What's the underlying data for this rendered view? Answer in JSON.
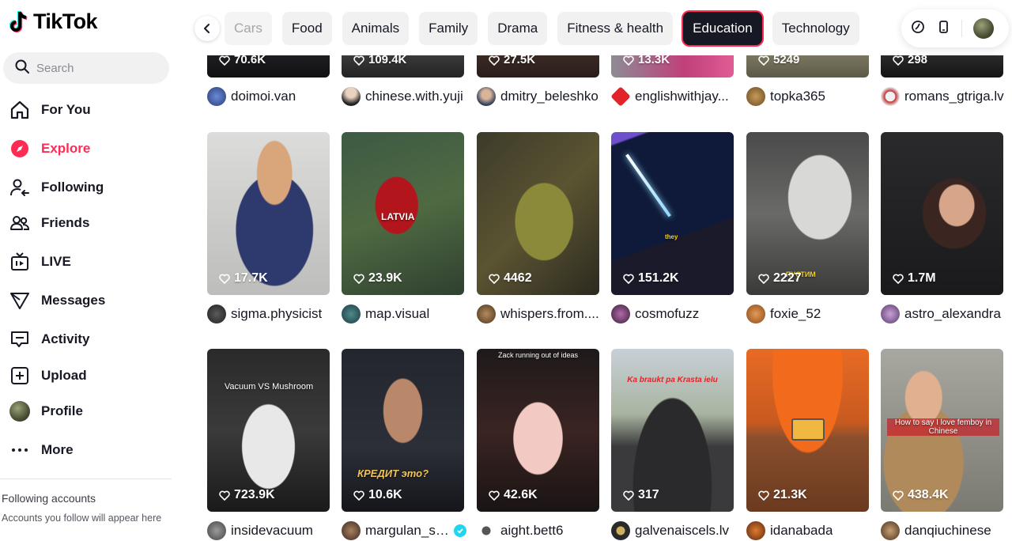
{
  "app": {
    "name": "TikTok"
  },
  "search": {
    "placeholder": "Search"
  },
  "nav": [
    {
      "label": "For You",
      "icon": "home-icon"
    },
    {
      "label": "Explore",
      "icon": "compass-icon",
      "active": true
    },
    {
      "label": "Following",
      "icon": "following-icon"
    },
    {
      "label": "Friends",
      "icon": "friends-icon"
    },
    {
      "label": "LIVE",
      "icon": "live-icon"
    },
    {
      "label": "Messages",
      "icon": "messages-icon"
    },
    {
      "label": "Activity",
      "icon": "activity-icon"
    },
    {
      "label": "Upload",
      "icon": "upload-icon"
    },
    {
      "label": "Profile",
      "icon": "profile-avatar"
    },
    {
      "label": "More",
      "icon": "more-icon"
    }
  ],
  "following_accounts": {
    "title": "Following accounts",
    "subtitle": "Accounts you follow will appear here"
  },
  "categories": [
    "Cars",
    "Food",
    "Animals",
    "Family",
    "Drama",
    "Fitness & health",
    "Education",
    "Technology"
  ],
  "active_category": "Education",
  "colors": {
    "accent": "#fe2c55",
    "verified": "#20d5ec",
    "chip_bg": "#f1f1f2"
  },
  "rows": [
    {
      "videos": [
        {
          "likes": "70.6K",
          "author": "doimoi.van"
        },
        {
          "likes": "109.4K",
          "author": "chinese.with.yuji"
        },
        {
          "likes": "27.5K",
          "author": "dmitry_beleshko"
        },
        {
          "likes": "13.3K",
          "author": "englishwithjay..."
        },
        {
          "likes": "5249",
          "author": "topka365"
        },
        {
          "likes": "298",
          "author": "romans_gtriga.lv"
        }
      ]
    },
    {
      "videos": [
        {
          "likes": "17.7K",
          "author": "sigma.physicist"
        },
        {
          "likes": "23.9K",
          "author": "map.visual",
          "overlay": "LATVIA"
        },
        {
          "likes": "4462",
          "author": "whispers.from...."
        },
        {
          "likes": "151.2K",
          "author": "cosmofuzz",
          "overlay": "they"
        },
        {
          "likes": "2227",
          "author": "foxie_52",
          "overlay": "ПУСТИМ"
        },
        {
          "likes": "1.7M",
          "author": "astro_alexandra"
        }
      ]
    },
    {
      "videos": [
        {
          "likes": "723.9K",
          "author": "insidevacuum",
          "overlay": "Vacuum VS Mushroom"
        },
        {
          "likes": "10.6K",
          "author": "margulan_se...",
          "verified": true,
          "overlay": "КРЕДИТ это?"
        },
        {
          "likes": "42.6K",
          "author": "aight.bett6",
          "overlay": "Zack running out of ideas"
        },
        {
          "likes": "317",
          "author": "galvenaiscels.lv",
          "overlay": "Ka braukt pa Krasta ielu"
        },
        {
          "likes": "21.3K",
          "author": "idanabada"
        },
        {
          "likes": "438.4K",
          "author": "danqiuchinese",
          "overlay": "How to say I love femboy in Chinese"
        }
      ]
    }
  ]
}
